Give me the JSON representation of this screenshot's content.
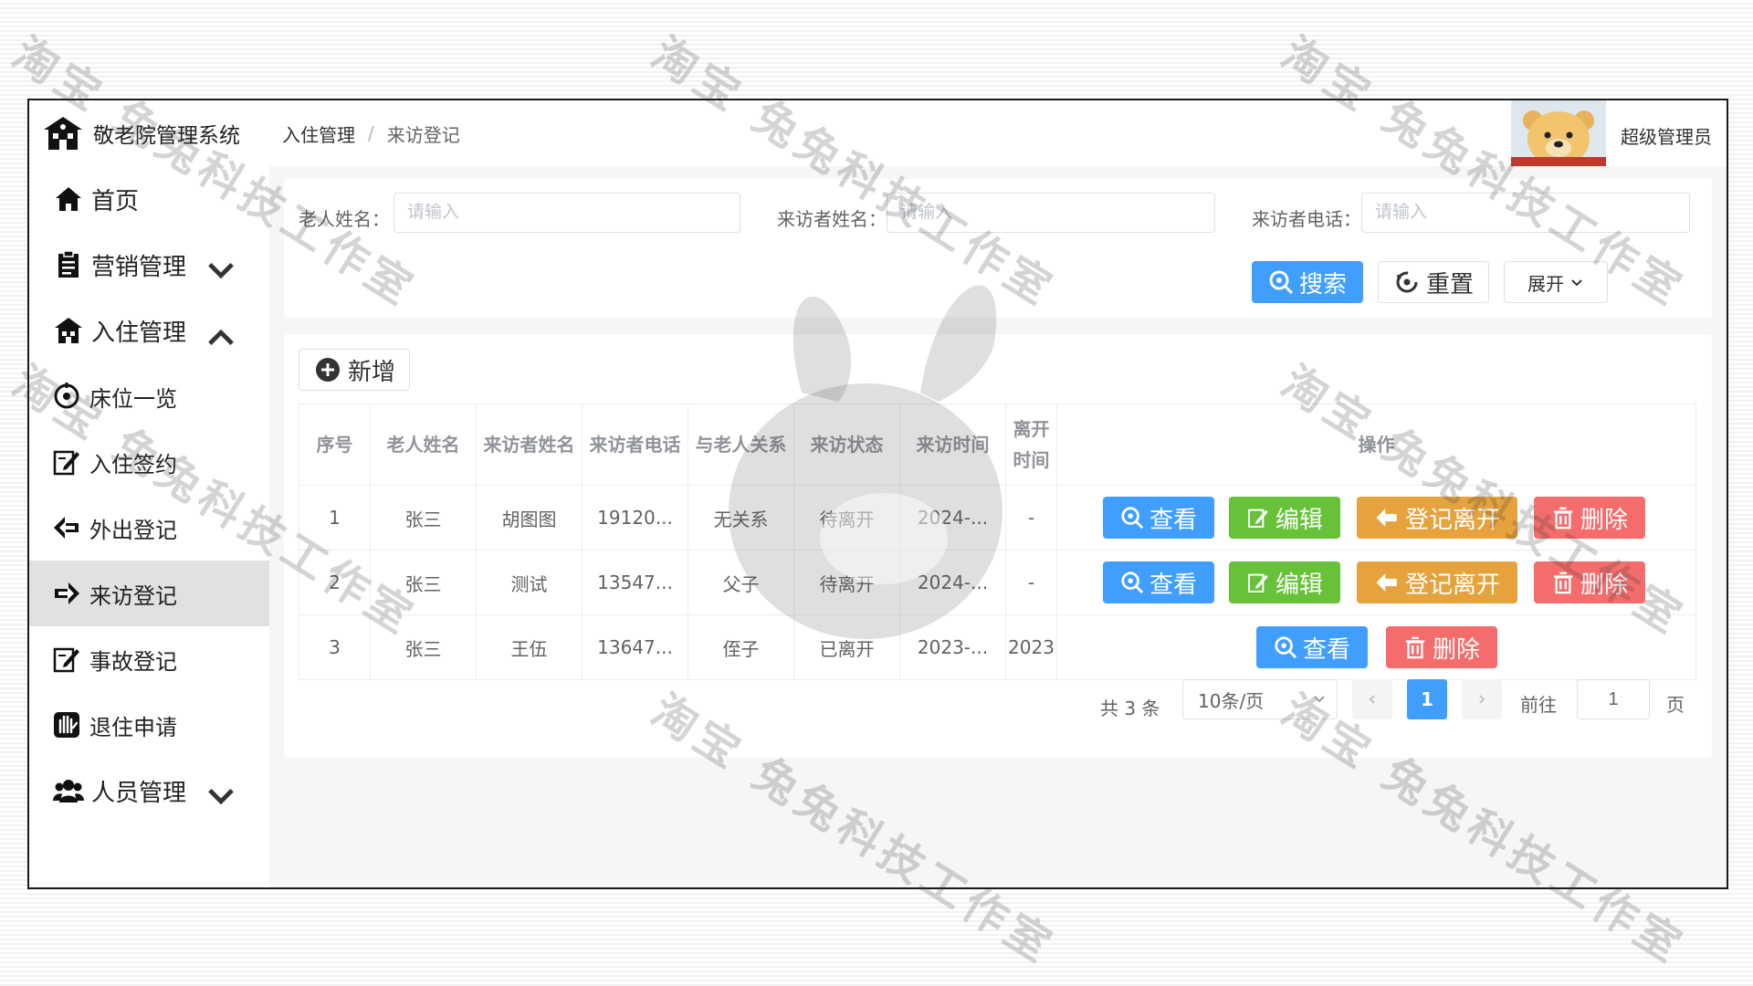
{
  "brand": {
    "title": "敬老院管理系统"
  },
  "sidebar": {
    "items": [
      {
        "label": "首页",
        "icon": "home-icon"
      },
      {
        "label": "营销管理",
        "icon": "clipboard-icon",
        "expand": "chevron-down-icon"
      },
      {
        "label": "入住管理",
        "icon": "house-icon",
        "expand": "chevron-up-icon"
      },
      {
        "label": "床位一览",
        "icon": "target-icon"
      },
      {
        "label": "入住签约",
        "icon": "edit-icon"
      },
      {
        "label": "外出登记",
        "icon": "arrow-left-icon"
      },
      {
        "label": "来访登记",
        "icon": "arrow-right-icon",
        "active": true
      },
      {
        "label": "事故登记",
        "icon": "edit-icon"
      },
      {
        "label": "退住申请",
        "icon": "hand-icon"
      },
      {
        "label": "人员管理",
        "icon": "people-icon",
        "expand": "chevron-down-icon"
      }
    ]
  },
  "header": {
    "breadcrumb": [
      "入住管理",
      "来访登记"
    ],
    "breadcrumb_sep": "/",
    "user": "超级管理员"
  },
  "search": {
    "elder_label": "老人姓名：",
    "visitor_label": "来访者姓名：",
    "phone_label": "来访者电话：",
    "placeholder": "请输入",
    "search_btn": "搜索",
    "reset_btn": "重置",
    "expand_btn": "展开"
  },
  "toolbar": {
    "add_btn": "新增"
  },
  "table": {
    "headers": [
      "序号",
      "老人姓名",
      "来访者姓名",
      "来访者电话",
      "与老人关系",
      "来访状态",
      "来访时间",
      "离开时间",
      "操作"
    ],
    "rows": [
      {
        "no": "1",
        "elder": "张三",
        "visitor": "胡图图",
        "phone": "19120...",
        "relation": "无关系",
        "status": "待离开",
        "visit_time": "2024-...",
        "leave_time": "-"
      },
      {
        "no": "2",
        "elder": "张三",
        "visitor": "测试",
        "phone": "13547...",
        "relation": "父子",
        "status": "待离开",
        "visit_time": "2024-...",
        "leave_time": "-"
      },
      {
        "no": "3",
        "elder": "张三",
        "visitor": "王伍",
        "phone": "13647...",
        "relation": "侄子",
        "status": "已离开",
        "visit_time": "2023-...",
        "leave_time": "2023"
      }
    ],
    "actions": {
      "view": "查看",
      "edit": "编辑",
      "leave": "登记离开",
      "delete": "删除"
    }
  },
  "pagination": {
    "total": "共 3 条",
    "page_size": "10条/页",
    "current": "1",
    "goto_label": "前往",
    "goto_value": "1",
    "page_suffix": "页"
  },
  "watermark": {
    "text": "淘宝 兔兔科技工作室"
  },
  "colors": {
    "primary": "#409eff",
    "success": "#67c23a",
    "warning": "#e6a23c",
    "danger": "#f56c6c",
    "active_bg": "#e1e1e1"
  }
}
